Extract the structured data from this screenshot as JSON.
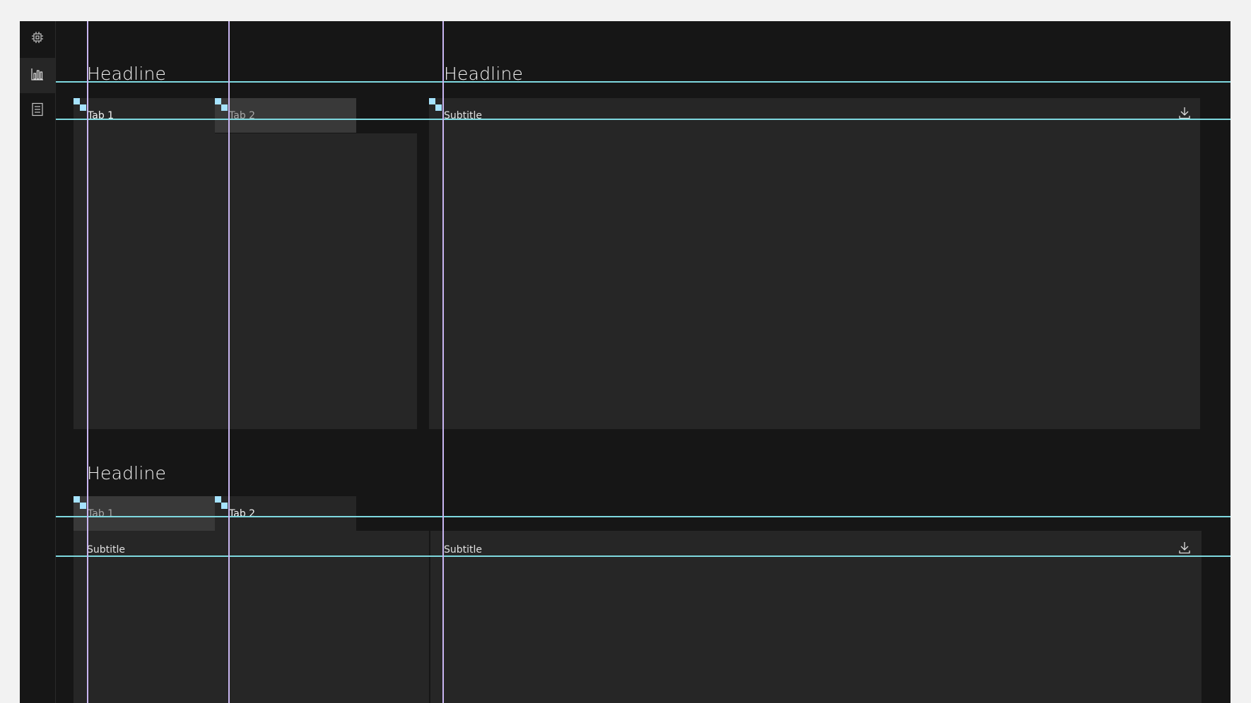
{
  "sidebar": {
    "items": [
      {
        "icon": "chip-icon",
        "active": false
      },
      {
        "icon": "bar-chart-icon",
        "active": true
      },
      {
        "icon": "report-icon",
        "active": false
      }
    ]
  },
  "section1": {
    "headline_left": "Headline",
    "headline_right": "Headline",
    "tabs": [
      {
        "label": "Tab 1",
        "selected": false
      },
      {
        "label": "Tab 2",
        "selected": true
      }
    ],
    "card_right_subtitle": "Subtitle",
    "download_icon": "download-icon"
  },
  "section2": {
    "headline": "Headline",
    "tabs": [
      {
        "label": "Tab 1",
        "selected": true
      },
      {
        "label": "Tab 2",
        "selected": false
      }
    ],
    "card_left_subtitle": "Subtitle",
    "card_right_subtitle": "Subtitle",
    "download_icon": "download-icon"
  },
  "colors": {
    "background": "#161616",
    "panel": "#262626",
    "selected_tab": "#393939",
    "guide_horizontal": "#7fd9e0",
    "guide_vertical": "#c9b6f2",
    "marker": "#a6e3ff"
  }
}
